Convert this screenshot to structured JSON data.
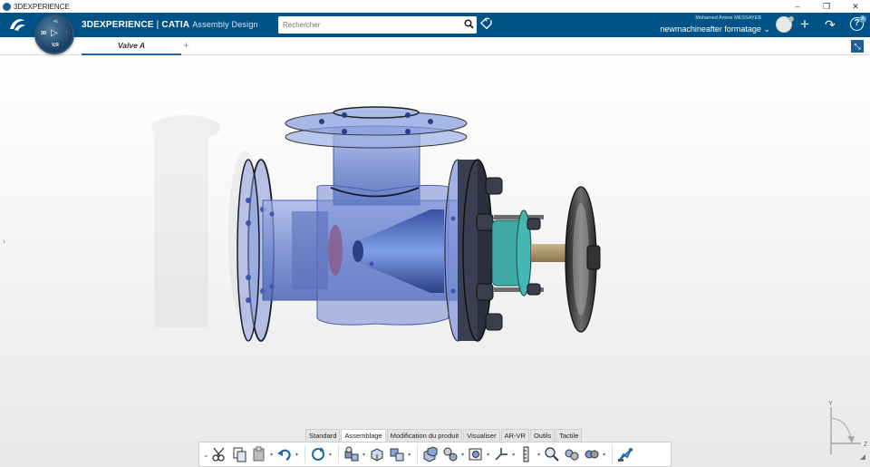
{
  "window": {
    "title": "3DEXPERIENCE",
    "minimize": "–",
    "restore": "❐",
    "close": "✕"
  },
  "appbar": {
    "logo_glyph": "3DS",
    "compass": {
      "top": "⁸/ₖ",
      "left": "3D",
      "ver": "V,R",
      "right": "ⁱ"
    },
    "brand_bold": "3DEXPERIENCE",
    "brand_sep": " | ",
    "brand_catia": "CATIA",
    "app_name": "Assembly Design",
    "search_placeholder": "Rechercher",
    "user_name": "Mohamed Amine MESSAYEB",
    "space_name": "newmachineafter formatage",
    "space_chevron": "⌄",
    "plus": "+",
    "share": "↷",
    "help": "?",
    "help_badge": "A"
  },
  "tabs": {
    "document_tab": "Valve A",
    "add_tab": "+",
    "expand": "⤡"
  },
  "viewport": {
    "side_arrow": "›",
    "axis_y": "Y",
    "axis_z": "Z"
  },
  "command_tabs": [
    "Standard",
    "Assemblage",
    "Modification du produit",
    "Visualiser",
    "AR-VR",
    "Outils",
    "Tactile"
  ],
  "active_command_tab": "Assemblage",
  "colors": {
    "appbar": "#005386",
    "accent": "#1f6aa5",
    "valve_body": "#6f86cf",
    "flange_dark": "#2a2f3d",
    "teal": "#3fa9a7"
  }
}
